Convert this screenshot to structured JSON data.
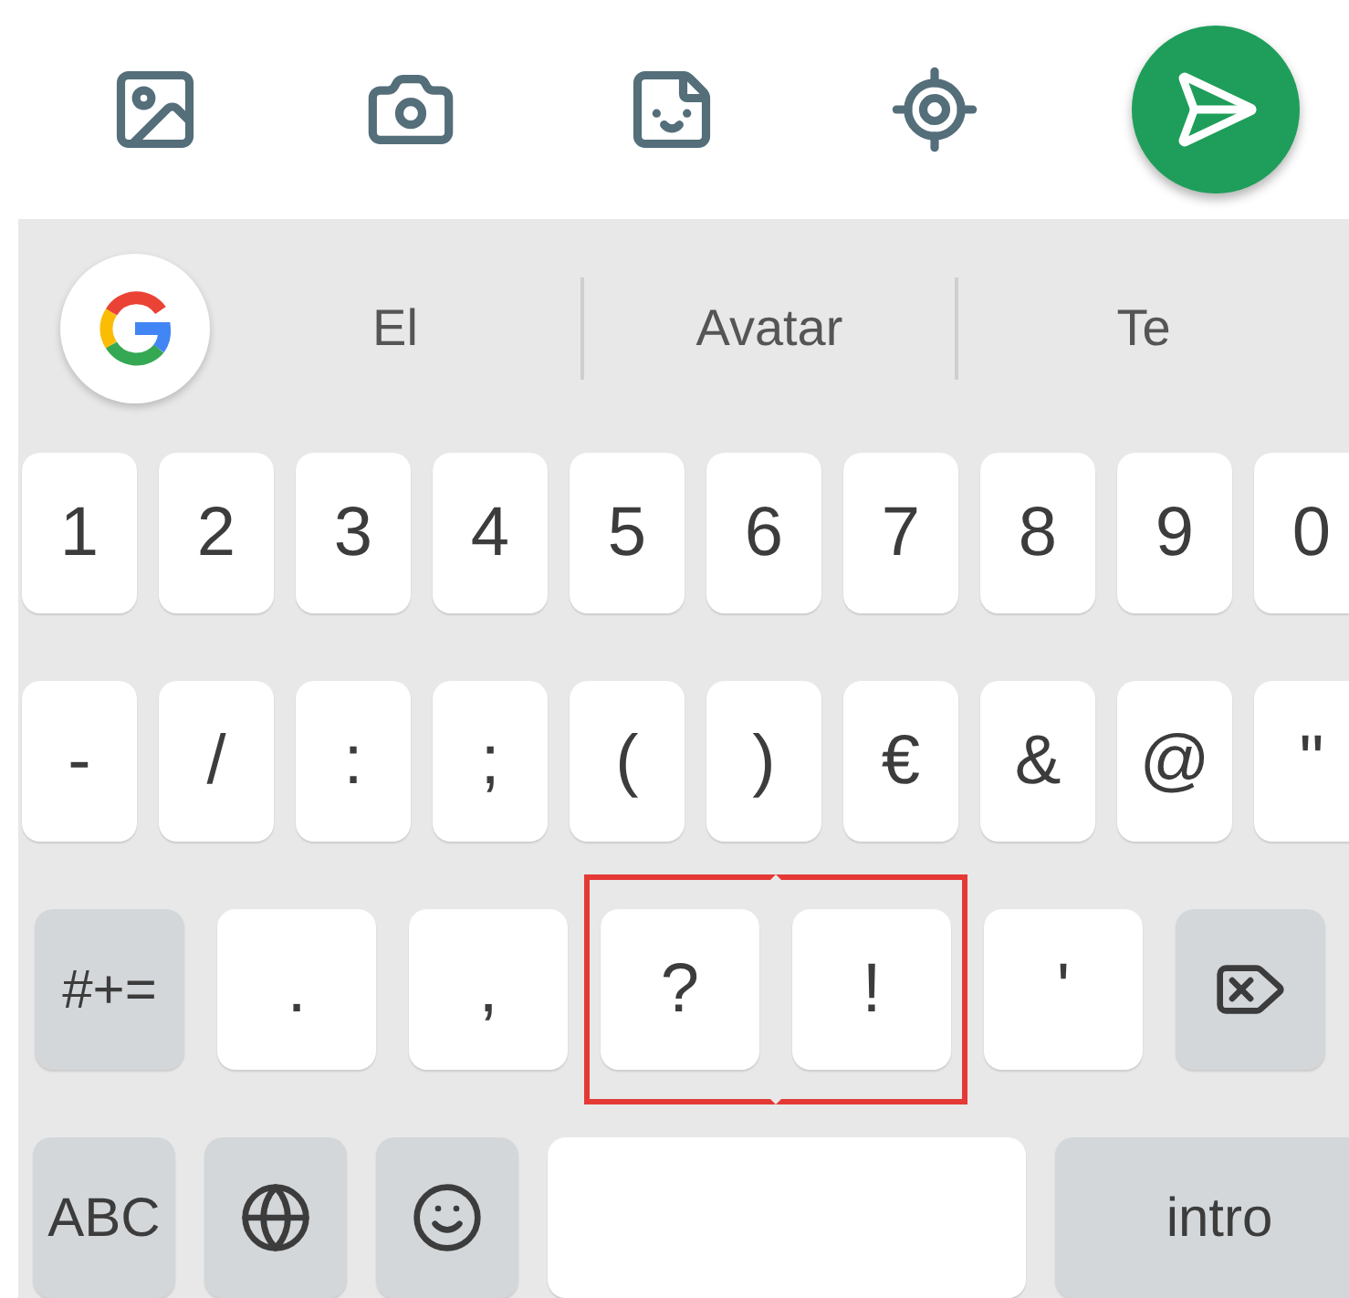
{
  "suggestions": [
    "El",
    "Avatar",
    "Te"
  ],
  "rows": [
    {
      "keys": [
        {
          "kind": "char",
          "label": "1",
          "highlighted": false
        },
        {
          "kind": "char",
          "label": "2",
          "highlighted": false
        },
        {
          "kind": "char",
          "label": "3",
          "highlighted": false
        },
        {
          "kind": "char",
          "label": "4",
          "highlighted": false
        },
        {
          "kind": "char",
          "label": "5",
          "highlighted": false
        },
        {
          "kind": "char",
          "label": "6",
          "highlighted": false
        },
        {
          "kind": "char",
          "label": "7",
          "highlighted": false
        },
        {
          "kind": "char",
          "label": "8",
          "highlighted": false
        },
        {
          "kind": "char",
          "label": "9",
          "highlighted": false
        },
        {
          "kind": "char",
          "label": "0",
          "highlighted": false
        }
      ]
    },
    {
      "keys": [
        {
          "kind": "char",
          "label": "-",
          "highlighted": false
        },
        {
          "kind": "char",
          "label": "/",
          "highlighted": false
        },
        {
          "kind": "char",
          "label": ":",
          "highlighted": false
        },
        {
          "kind": "char",
          "label": ";",
          "highlighted": false
        },
        {
          "kind": "char",
          "label": "(",
          "highlighted": false
        },
        {
          "kind": "char",
          "label": ")",
          "highlighted": false
        },
        {
          "kind": "char",
          "label": "€",
          "highlighted": false
        },
        {
          "kind": "char",
          "label": "&",
          "highlighted": false
        },
        {
          "kind": "char",
          "label": "@",
          "highlighted": false
        },
        {
          "kind": "char",
          "label": "\"",
          "highlighted": false
        }
      ]
    },
    {
      "keys": [
        {
          "kind": "func",
          "label": "#+=",
          "highlighted": false
        },
        {
          "kind": "char",
          "label": ".",
          "highlighted": false
        },
        {
          "kind": "char",
          "label": ",",
          "highlighted": false
        },
        {
          "kind": "char",
          "label": "?",
          "highlighted": true
        },
        {
          "kind": "char",
          "label": "!",
          "highlighted": true
        },
        {
          "kind": "char",
          "label": "'",
          "highlighted": false
        },
        {
          "kind": "backspace",
          "highlighted": false
        }
      ]
    },
    {
      "keys": [
        {
          "kind": "func",
          "label": "ABC",
          "highlighted": false
        },
        {
          "kind": "globe",
          "highlighted": false
        },
        {
          "kind": "emoji",
          "highlighted": false
        },
        {
          "kind": "space",
          "highlighted": false
        },
        {
          "kind": "func",
          "label": "intro",
          "highlighted": false
        }
      ]
    }
  ]
}
